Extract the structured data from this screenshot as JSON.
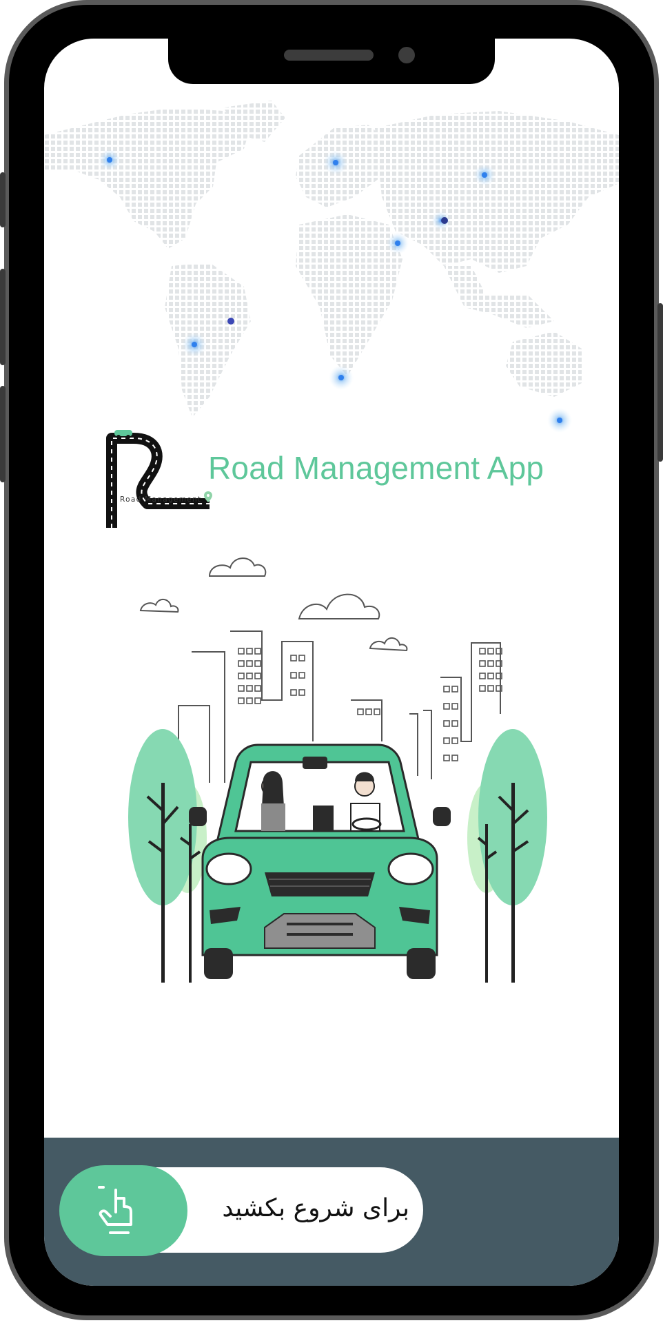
{
  "app": {
    "title": "Road Management App",
    "logo_caption": "Road Management"
  },
  "onboarding": {
    "swipe_label": "برای شروع بکشید"
  },
  "colors": {
    "accent": "#5ec79a",
    "panel": "#455a64",
    "map_dots": "#e3e6e8",
    "map_pin": "#2f80ed"
  },
  "icons": {
    "swipe": "swipe-hand-icon",
    "logo": "road-logo-icon",
    "map": "world-map-icon"
  }
}
